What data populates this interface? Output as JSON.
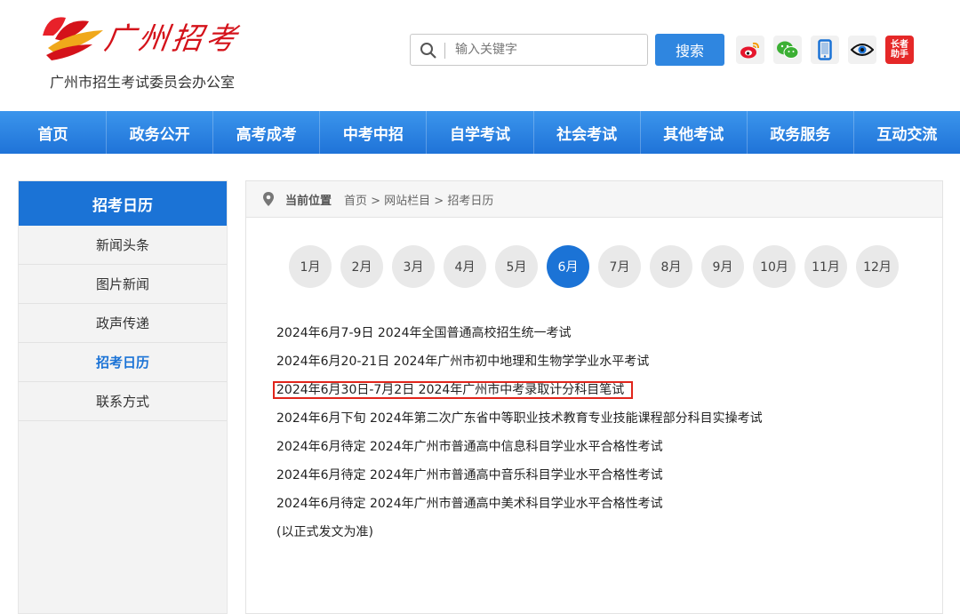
{
  "header": {
    "logo_title": "广州招考",
    "logo_subtitle": "广州市招生考试委员会办公室",
    "search_placeholder": "输入关键字",
    "search_button": "搜索",
    "elder_badge_line1": "长者",
    "elder_badge_line2": "助手"
  },
  "nav": {
    "items": [
      "首页",
      "政务公开",
      "高考成考",
      "中考中招",
      "自学考试",
      "社会考试",
      "其他考试",
      "政务服务",
      "互动交流"
    ]
  },
  "sidebar": {
    "title": "招考日历",
    "items": [
      "新闻头条",
      "图片新闻",
      "政声传递",
      "招考日历",
      "联系方式"
    ]
  },
  "breadcrumb": {
    "label": "当前位置",
    "path": "首页 > 网站栏目 > 招考日历"
  },
  "months": [
    "1月",
    "2月",
    "3月",
    "4月",
    "5月",
    "6月",
    "7月",
    "8月",
    "9月",
    "10月",
    "11月",
    "12月"
  ],
  "events": [
    "2024年6月7-9日 2024年全国普通高校招生统一考试",
    "2024年6月20-21日 2024年广州市初中地理和生物学学业水平考试",
    "2024年6月30日-7月2日 2024年广州市中考录取计分科目笔试",
    "2024年6月下旬 2024年第二次广东省中等职业技术教育专业技能课程部分科目实操考试",
    "2024年6月待定 2024年广州市普通高中信息科目学业水平合格性考试",
    "2024年6月待定 2024年广州市普通高中音乐科目学业水平合格性考试",
    "2024年6月待定 2024年广州市普通高中美术科目学业水平合格性考试",
    "(以正式发文为准)"
  ],
  "colors": {
    "brand_red": "#d4121a",
    "nav_blue": "#1f73d8",
    "highlight_red": "#e1251b"
  }
}
